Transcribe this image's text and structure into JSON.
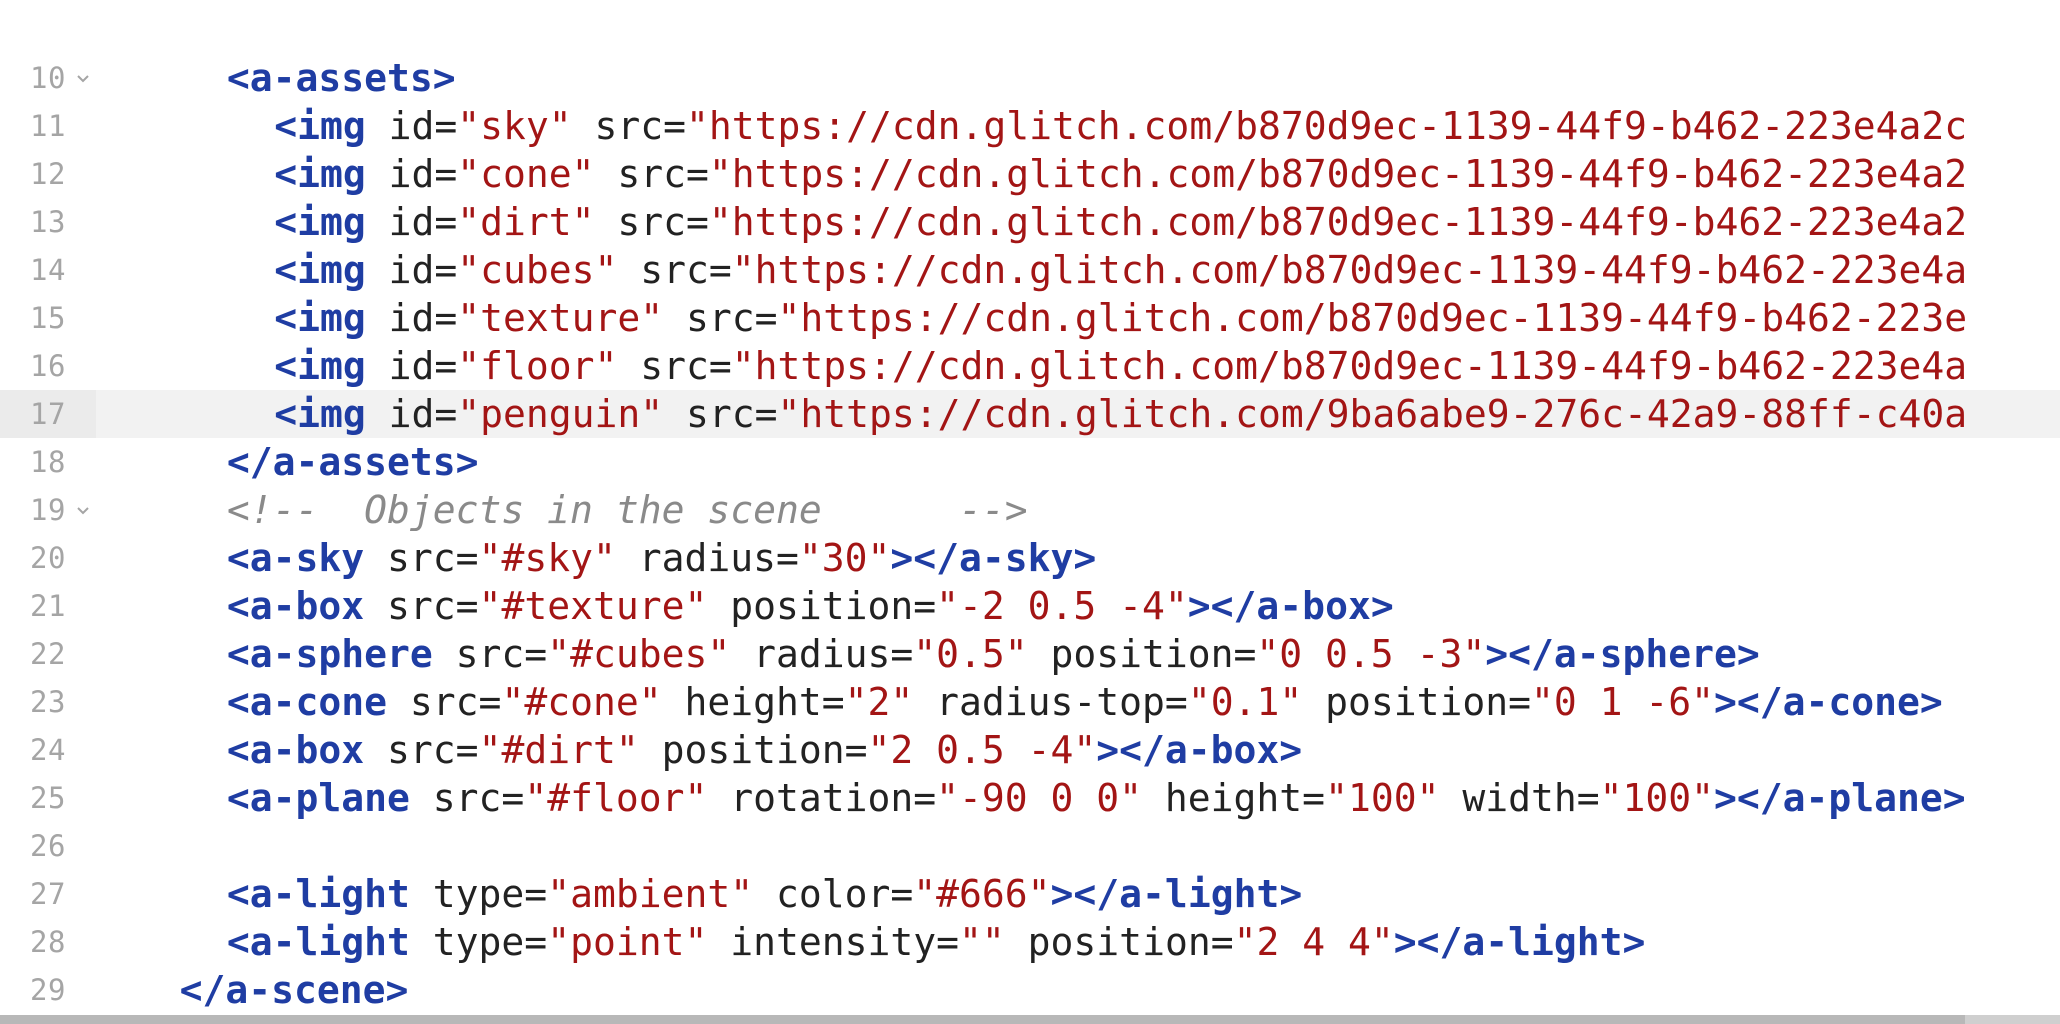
{
  "editor": {
    "lines": [
      {
        "number": "10",
        "folded": true,
        "indent": 6,
        "tokens": [
          {
            "t": "<a-assets>",
            "c": "tag"
          }
        ]
      },
      {
        "number": "11",
        "folded": false,
        "indent": 8,
        "tokens": [
          {
            "t": "<img",
            "c": "tag"
          },
          {
            "t": " id=",
            "c": "attr"
          },
          {
            "t": "\"sky\"",
            "c": "string"
          },
          {
            "t": " src=",
            "c": "attr"
          },
          {
            "t": "\"https://cdn.glitch.com/b870d9ec-1139-44f9-b462-223e4a2c",
            "c": "string"
          }
        ]
      },
      {
        "number": "12",
        "folded": false,
        "indent": 8,
        "tokens": [
          {
            "t": "<img",
            "c": "tag"
          },
          {
            "t": " id=",
            "c": "attr"
          },
          {
            "t": "\"cone\"",
            "c": "string"
          },
          {
            "t": " src=",
            "c": "attr"
          },
          {
            "t": "\"https://cdn.glitch.com/b870d9ec-1139-44f9-b462-223e4a2",
            "c": "string"
          }
        ]
      },
      {
        "number": "13",
        "folded": false,
        "indent": 8,
        "tokens": [
          {
            "t": "<img",
            "c": "tag"
          },
          {
            "t": " id=",
            "c": "attr"
          },
          {
            "t": "\"dirt\"",
            "c": "string"
          },
          {
            "t": " src=",
            "c": "attr"
          },
          {
            "t": "\"https://cdn.glitch.com/b870d9ec-1139-44f9-b462-223e4a2",
            "c": "string"
          }
        ]
      },
      {
        "number": "14",
        "folded": false,
        "indent": 8,
        "tokens": [
          {
            "t": "<img",
            "c": "tag"
          },
          {
            "t": " id=",
            "c": "attr"
          },
          {
            "t": "\"cubes\"",
            "c": "string"
          },
          {
            "t": " src=",
            "c": "attr"
          },
          {
            "t": "\"https://cdn.glitch.com/b870d9ec-1139-44f9-b462-223e4a",
            "c": "string"
          }
        ]
      },
      {
        "number": "15",
        "folded": false,
        "indent": 8,
        "tokens": [
          {
            "t": "<img",
            "c": "tag"
          },
          {
            "t": " id=",
            "c": "attr"
          },
          {
            "t": "\"texture\"",
            "c": "string"
          },
          {
            "t": " src=",
            "c": "attr"
          },
          {
            "t": "\"https://cdn.glitch.com/b870d9ec-1139-44f9-b462-223e",
            "c": "string"
          }
        ]
      },
      {
        "number": "16",
        "folded": false,
        "indent": 8,
        "tokens": [
          {
            "t": "<img",
            "c": "tag"
          },
          {
            "t": " id=",
            "c": "attr"
          },
          {
            "t": "\"floor\"",
            "c": "string"
          },
          {
            "t": " src=",
            "c": "attr"
          },
          {
            "t": "\"https://cdn.glitch.com/b870d9ec-1139-44f9-b462-223e4a",
            "c": "string"
          }
        ]
      },
      {
        "number": "17",
        "folded": false,
        "active": true,
        "indent": 8,
        "tokens": [
          {
            "t": "<img",
            "c": "tag"
          },
          {
            "t": " id=",
            "c": "attr"
          },
          {
            "t": "\"penguin\"",
            "c": "string"
          },
          {
            "t": " src=",
            "c": "attr"
          },
          {
            "t": "\"https://cdn.glitch.com/9ba6abe9-276c-42a9-88ff-c40a",
            "c": "string"
          }
        ]
      },
      {
        "number": "18",
        "folded": false,
        "indent": 6,
        "tokens": [
          {
            "t": "</a-assets>",
            "c": "tag"
          }
        ]
      },
      {
        "number": "19",
        "folded": true,
        "indent": 6,
        "tokens": [
          {
            "t": "<!--  Objects in the scene      -->",
            "c": "comment"
          }
        ]
      },
      {
        "number": "20",
        "folded": false,
        "indent": 6,
        "tokens": [
          {
            "t": "<a-sky",
            "c": "tag"
          },
          {
            "t": " src=",
            "c": "attr"
          },
          {
            "t": "\"#sky\"",
            "c": "string"
          },
          {
            "t": " radius=",
            "c": "attr"
          },
          {
            "t": "\"30\"",
            "c": "string"
          },
          {
            "t": "></a-sky>",
            "c": "tag"
          }
        ]
      },
      {
        "number": "21",
        "folded": false,
        "indent": 6,
        "tokens": [
          {
            "t": "<a-box",
            "c": "tag"
          },
          {
            "t": " src=",
            "c": "attr"
          },
          {
            "t": "\"#texture\"",
            "c": "string"
          },
          {
            "t": " position=",
            "c": "attr"
          },
          {
            "t": "\"-2 0.5 -4\"",
            "c": "string"
          },
          {
            "t": "></a-box>",
            "c": "tag"
          }
        ]
      },
      {
        "number": "22",
        "folded": false,
        "indent": 6,
        "tokens": [
          {
            "t": "<a-sphere",
            "c": "tag"
          },
          {
            "t": " src=",
            "c": "attr"
          },
          {
            "t": "\"#cubes\"",
            "c": "string"
          },
          {
            "t": " radius=",
            "c": "attr"
          },
          {
            "t": "\"0.5\"",
            "c": "string"
          },
          {
            "t": " position=",
            "c": "attr"
          },
          {
            "t": "\"0 0.5 -3\"",
            "c": "string"
          },
          {
            "t": "></a-sphere>",
            "c": "tag"
          }
        ]
      },
      {
        "number": "23",
        "folded": false,
        "indent": 6,
        "tokens": [
          {
            "t": "<a-cone",
            "c": "tag"
          },
          {
            "t": " src=",
            "c": "attr"
          },
          {
            "t": "\"#cone\"",
            "c": "string"
          },
          {
            "t": " height=",
            "c": "attr"
          },
          {
            "t": "\"2\"",
            "c": "string"
          },
          {
            "t": " radius-top=",
            "c": "attr"
          },
          {
            "t": "\"0.1\"",
            "c": "string"
          },
          {
            "t": " position=",
            "c": "attr"
          },
          {
            "t": "\"0 1 -6\"",
            "c": "string"
          },
          {
            "t": "></a-cone>",
            "c": "tag"
          }
        ]
      },
      {
        "number": "24",
        "folded": false,
        "indent": 6,
        "tokens": [
          {
            "t": "<a-box",
            "c": "tag"
          },
          {
            "t": " src=",
            "c": "attr"
          },
          {
            "t": "\"#dirt\"",
            "c": "string"
          },
          {
            "t": " position=",
            "c": "attr"
          },
          {
            "t": "\"2 0.5 -4\"",
            "c": "string"
          },
          {
            "t": "></a-box>",
            "c": "tag"
          }
        ]
      },
      {
        "number": "25",
        "folded": false,
        "indent": 6,
        "tokens": [
          {
            "t": "<a-plane",
            "c": "tag"
          },
          {
            "t": " src=",
            "c": "attr"
          },
          {
            "t": "\"#floor\"",
            "c": "string"
          },
          {
            "t": " rotation=",
            "c": "attr"
          },
          {
            "t": "\"-90 0 0\"",
            "c": "string"
          },
          {
            "t": " height=",
            "c": "attr"
          },
          {
            "t": "\"100\"",
            "c": "string"
          },
          {
            "t": " width=",
            "c": "attr"
          },
          {
            "t": "\"100\"",
            "c": "string"
          },
          {
            "t": "></a-plane>",
            "c": "tag"
          }
        ]
      },
      {
        "number": "26",
        "folded": false,
        "indent": 0,
        "tokens": []
      },
      {
        "number": "27",
        "folded": false,
        "indent": 6,
        "tokens": [
          {
            "t": "<a-light",
            "c": "tag"
          },
          {
            "t": " type=",
            "c": "attr"
          },
          {
            "t": "\"ambient\"",
            "c": "string"
          },
          {
            "t": " color=",
            "c": "attr"
          },
          {
            "t": "\"#666\"",
            "c": "string"
          },
          {
            "t": "></a-light>",
            "c": "tag"
          }
        ]
      },
      {
        "number": "28",
        "folded": false,
        "indent": 6,
        "tokens": [
          {
            "t": "<a-light",
            "c": "tag"
          },
          {
            "t": " type=",
            "c": "attr"
          },
          {
            "t": "\"point\"",
            "c": "string"
          },
          {
            "t": " intensity=",
            "c": "attr"
          },
          {
            "t": "\"\"",
            "c": "string"
          },
          {
            "t": " position=",
            "c": "attr"
          },
          {
            "t": "\"2 4 4\"",
            "c": "string"
          },
          {
            "t": "></a-light>",
            "c": "tag"
          }
        ]
      },
      {
        "number": "29",
        "folded": false,
        "indent": 4,
        "tokens": [
          {
            "t": "</a-scene>",
            "c": "tag"
          }
        ]
      }
    ]
  }
}
